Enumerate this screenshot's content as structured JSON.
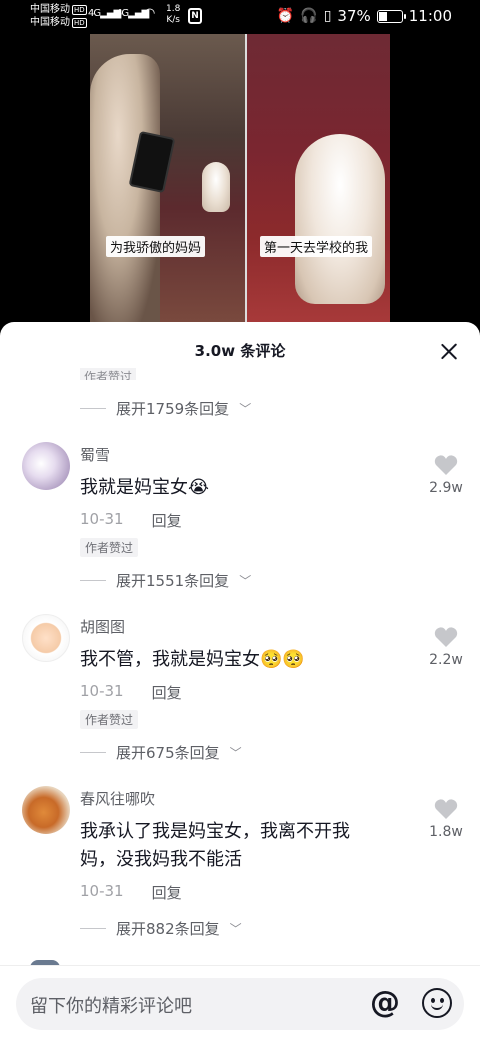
{
  "status_bar": {
    "carrier1": "中国移动",
    "carrier2": "中国移动",
    "hd": "HD",
    "net1": "4G",
    "net2": "4G",
    "speed_value": "1.8",
    "speed_unit": "K/s",
    "battery_percent": "37%",
    "battery_level": 0.37,
    "time": "11:00"
  },
  "video": {
    "caption_left": "为我骄傲的妈妈",
    "caption_right": "第一天去学校的我"
  },
  "sheet": {
    "title": "3.0w 条评论",
    "clipped_tag": "作者赞过",
    "first_expand": "展开1759条回复"
  },
  "comments": [
    {
      "username": "蜀雪",
      "text": "我就是妈宝女",
      "emoji": "😭",
      "date": "10-31",
      "reply_label": "回复",
      "tag": "作者赞过",
      "likes": "2.9w",
      "expand": "展开1551条回复"
    },
    {
      "username": "胡图图",
      "text": "我不管，我就是妈宝女",
      "emoji": "🥺🥺",
      "date": "10-31",
      "reply_label": "回复",
      "tag": "作者赞过",
      "likes": "2.2w",
      "expand": "展开675条回复"
    },
    {
      "username": "春风往哪吹",
      "text_line1": "我承认了我是妈宝女，我离不开我",
      "text_line2": "妈，没我妈我不能活",
      "date": "10-31",
      "reply_label": "回复",
      "likes": "1.8w",
      "expand": "展开882条回复"
    }
  ],
  "input": {
    "placeholder": "留下你的精彩评论吧",
    "at_symbol": "@"
  },
  "icons": {
    "close": "close-icon",
    "heart": "heart-icon",
    "chevron": "chevron-down-icon",
    "at": "at-icon",
    "emoji": "emoji-icon"
  }
}
